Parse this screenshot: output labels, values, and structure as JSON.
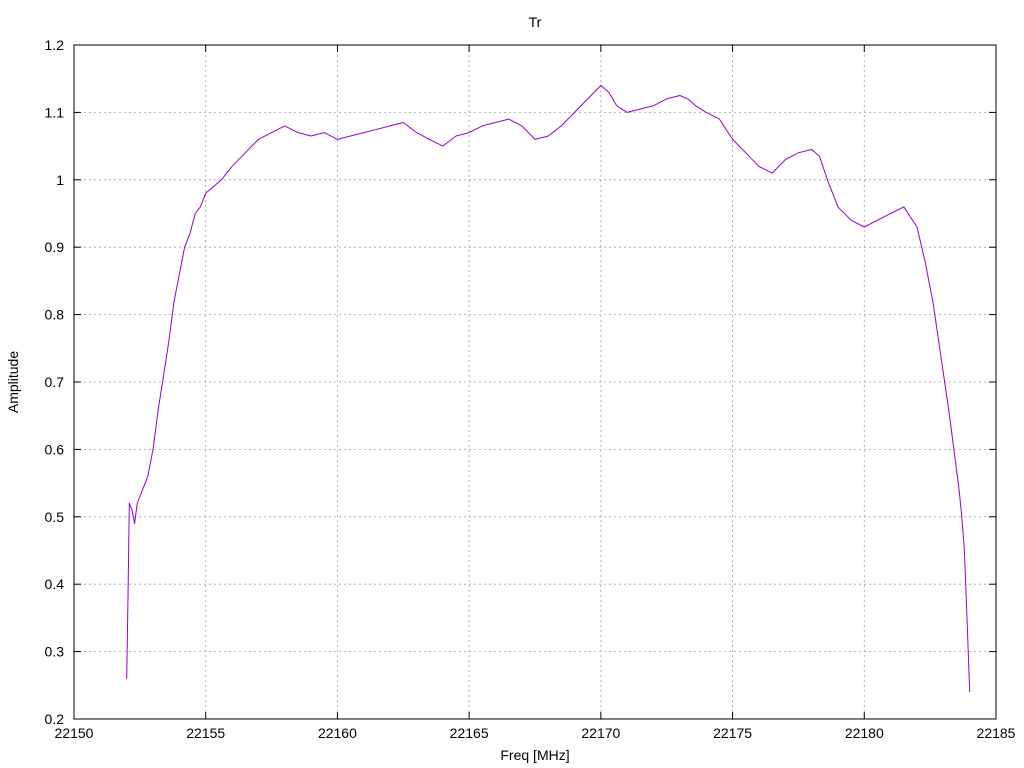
{
  "chart_data": {
    "type": "line",
    "title": "Tr",
    "xlabel": "Freq [MHz]",
    "ylabel": "Amplitude",
    "xlim": [
      22150,
      22185
    ],
    "ylim": [
      0.2,
      1.2
    ],
    "grid": true,
    "x_ticks": [
      {
        "value": 22150,
        "label": "22150"
      },
      {
        "value": 22155,
        "label": "22155"
      },
      {
        "value": 22160,
        "label": "22160"
      },
      {
        "value": 22165,
        "label": "22165"
      },
      {
        "value": 22170,
        "label": "22170"
      },
      {
        "value": 22175,
        "label": "22175"
      },
      {
        "value": 22180,
        "label": "22180"
      },
      {
        "value": 22185,
        "label": "22185"
      }
    ],
    "y_ticks": [
      {
        "value": 0.2,
        "label": "0.2"
      },
      {
        "value": 0.3,
        "label": "0.3"
      },
      {
        "value": 0.4,
        "label": "0.4"
      },
      {
        "value": 0.5,
        "label": "0.5"
      },
      {
        "value": 0.6,
        "label": "0.6"
      },
      {
        "value": 0.7,
        "label": "0.7"
      },
      {
        "value": 0.8,
        "label": "0.8"
      },
      {
        "value": 0.9,
        "label": "0.9"
      },
      {
        "value": 1.0,
        "label": "1"
      },
      {
        "value": 1.1,
        "label": "1.1"
      },
      {
        "value": 1.2,
        "label": "1.2"
      }
    ],
    "series": [
      {
        "color": "#9400d3",
        "x": [
          22152.0,
          22152.05,
          22152.1,
          22152.2,
          22152.3,
          22152.4,
          22152.5,
          22152.6,
          22152.8,
          22153.0,
          22153.2,
          22153.4,
          22153.6,
          22153.8,
          22154.0,
          22154.2,
          22154.4,
          22154.6,
          22154.8,
          22155.0,
          22155.3,
          22155.6,
          22156.0,
          22156.5,
          22157.0,
          22157.5,
          22158.0,
          22158.5,
          22159.0,
          22159.5,
          22160.0,
          22160.5,
          22161.0,
          22161.5,
          22162.0,
          22162.5,
          22163.0,
          22163.5,
          22164.0,
          22164.5,
          22165.0,
          22165.5,
          22166.0,
          22166.5,
          22167.0,
          22167.5,
          22168.0,
          22168.5,
          22169.0,
          22169.5,
          22170.0,
          22170.3,
          22170.6,
          22171.0,
          22171.5,
          22172.0,
          22172.5,
          22173.0,
          22173.3,
          22173.6,
          22174.0,
          22174.5,
          22175.0,
          22175.5,
          22176.0,
          22176.5,
          22177.0,
          22177.5,
          22178.0,
          22178.3,
          22178.6,
          22179.0,
          22179.5,
          22180.0,
          22180.5,
          22181.0,
          22181.5,
          22182.0,
          22182.3,
          22182.6,
          22182.9,
          22183.2,
          22183.4,
          22183.6,
          22183.7,
          22183.8,
          22183.9,
          22184.0
        ],
        "y": [
          0.26,
          0.38,
          0.52,
          0.51,
          0.49,
          0.52,
          0.53,
          0.54,
          0.56,
          0.6,
          0.66,
          0.71,
          0.76,
          0.82,
          0.86,
          0.9,
          0.92,
          0.95,
          0.96,
          0.98,
          0.99,
          1.0,
          1.02,
          1.04,
          1.06,
          1.07,
          1.08,
          1.07,
          1.065,
          1.07,
          1.06,
          1.065,
          1.07,
          1.075,
          1.08,
          1.085,
          1.07,
          1.06,
          1.05,
          1.065,
          1.07,
          1.08,
          1.085,
          1.09,
          1.08,
          1.06,
          1.065,
          1.08,
          1.1,
          1.12,
          1.14,
          1.13,
          1.11,
          1.1,
          1.105,
          1.11,
          1.12,
          1.125,
          1.12,
          1.11,
          1.1,
          1.09,
          1.06,
          1.04,
          1.02,
          1.01,
          1.03,
          1.04,
          1.045,
          1.035,
          1.0,
          0.96,
          0.94,
          0.93,
          0.94,
          0.95,
          0.96,
          0.93,
          0.88,
          0.82,
          0.74,
          0.66,
          0.6,
          0.54,
          0.5,
          0.45,
          0.35,
          0.24
        ]
      }
    ]
  }
}
